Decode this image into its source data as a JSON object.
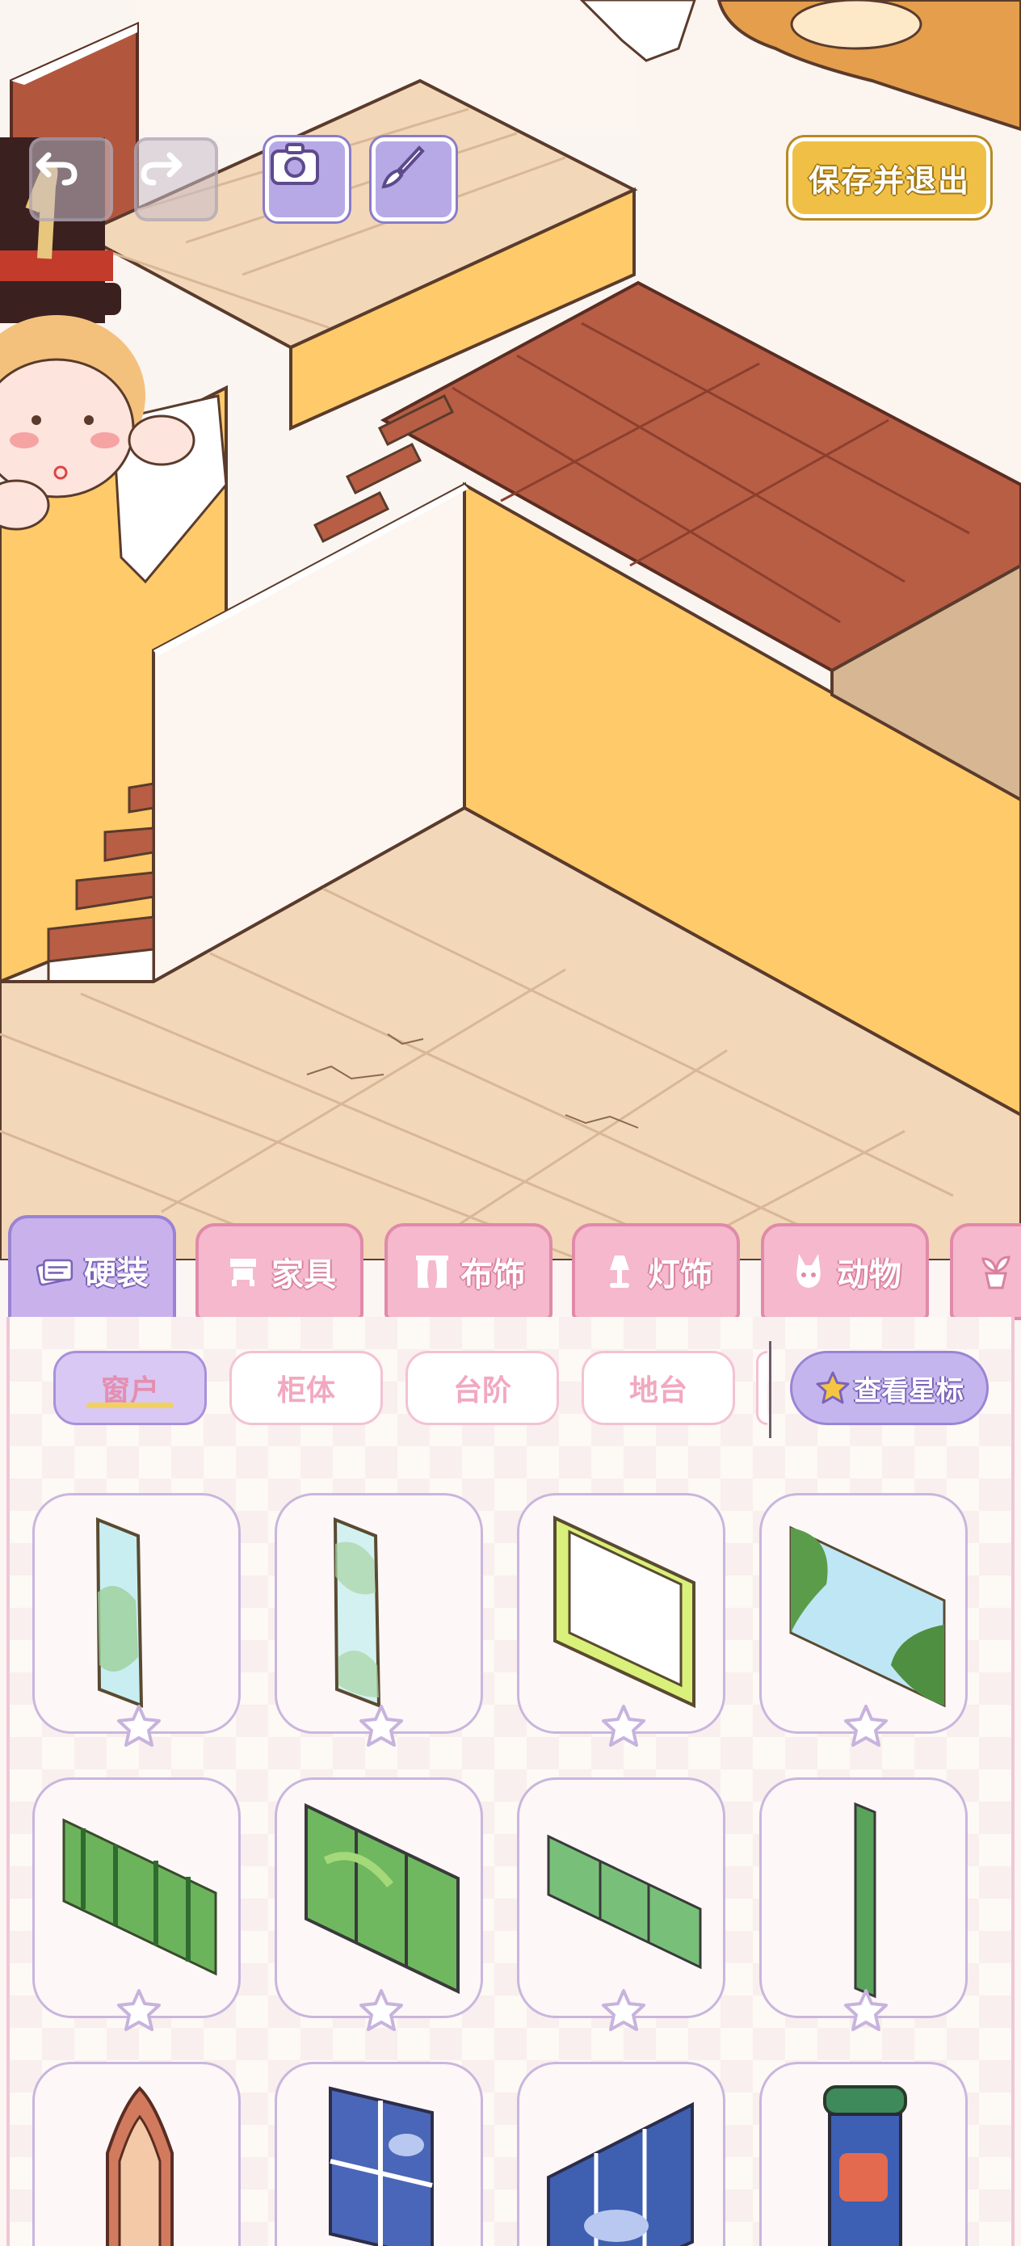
{
  "toolbar": {
    "undo_icon": "undo-arrow-icon",
    "redo_icon": "redo-arrow-icon",
    "camera_icon": "camera-icon",
    "brush_icon": "paintbrush-icon",
    "save_exit_label": "保存并退出"
  },
  "tabs": [
    {
      "label": "硬装",
      "icon": "cards-icon",
      "active": true
    },
    {
      "label": "家具",
      "icon": "cabinet-icon",
      "active": false
    },
    {
      "label": "布饰",
      "icon": "curtain-icon",
      "active": false
    },
    {
      "label": "灯饰",
      "icon": "lamp-icon",
      "active": false
    },
    {
      "label": "动物",
      "icon": "bunny-icon",
      "active": false
    },
    {
      "label": "",
      "icon": "plant-icon",
      "active": false
    }
  ],
  "subtabs": [
    {
      "label": "窗户",
      "active": true
    },
    {
      "label": "柜体",
      "active": false
    },
    {
      "label": "台阶",
      "active": false
    },
    {
      "label": "地台",
      "active": false
    }
  ],
  "view_starred_label": "查看星标",
  "items": [
    {
      "name": "window-glass-tall"
    },
    {
      "name": "window-glass-tall-clear"
    },
    {
      "name": "window-frame-green"
    },
    {
      "name": "window-forest-wide"
    },
    {
      "name": "window-jungle-panorama"
    },
    {
      "name": "window-jungle-triple"
    },
    {
      "name": "window-jungle-narrow"
    },
    {
      "name": "window-slit-vertical"
    },
    {
      "name": "window-arched-wood"
    },
    {
      "name": "window-blue-grid"
    },
    {
      "name": "window-blue-cloud"
    },
    {
      "name": "window-awning-green"
    }
  ],
  "colors": {
    "wall_yellow": "#ffca6a",
    "floor_light": "#f2d7b9",
    "floor_dark": "#b75e45",
    "tab_pink": "#f5b8cd",
    "tab_purple": "#c9b2ec",
    "save_gold": "#f0c046"
  }
}
